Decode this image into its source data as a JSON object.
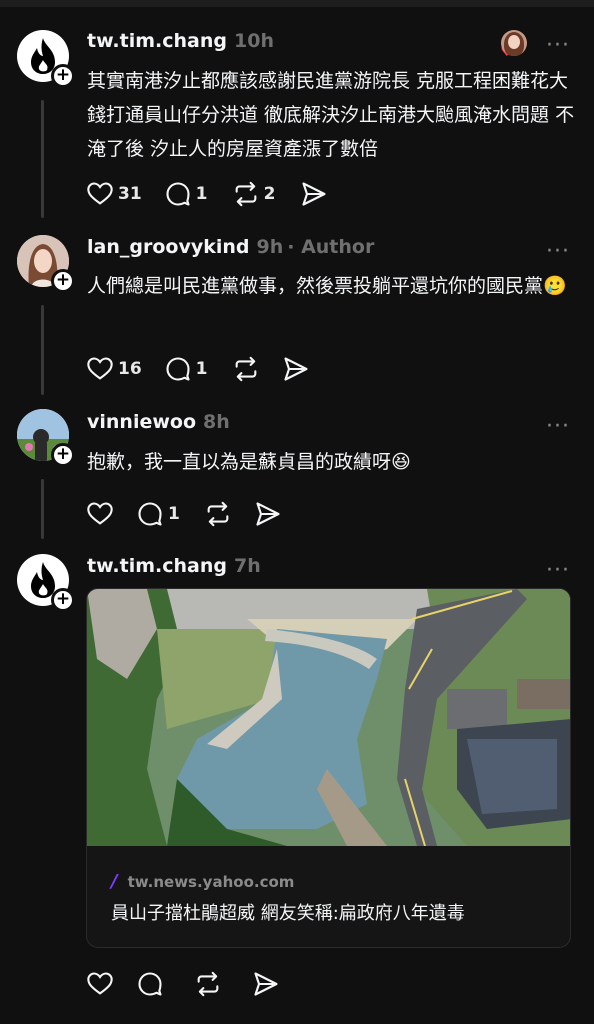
{
  "posts": [
    {
      "username": "tw.tim.chang",
      "time": "10h",
      "text": "其實南港汐止都應該感謝民進黨游院長  克服工程困難花大錢打通員山仔分洪道  徹底解決汐止南港大颱風淹水問題  不淹了後  汐止人的房屋資產漲了數倍",
      "likes": "31",
      "replies": "1",
      "reposts": "2",
      "avatar_icon": "threads-flame-logo",
      "more": "···"
    },
    {
      "username": "lan_groovykind",
      "time": "9h",
      "author_tag": "· Author",
      "text": "人們總是叫民進黨做事，然後票投躺平還坑你的國民黨🥲",
      "likes": "16",
      "replies": "1",
      "more": "···"
    },
    {
      "username": "vinniewoo",
      "time": "8h",
      "text": "抱歉，我一直以為是蘇貞昌的政績呀😆",
      "replies": "1",
      "more": "···"
    },
    {
      "username": "tw.tim.chang",
      "time": "7h",
      "more": "···",
      "link": {
        "domain": "tw.news.yahoo.com",
        "title": "員山子擋杜鵑超威 網友笑稱:扁政府八年遺毒"
      }
    }
  ],
  "colors": {
    "background": "#101010",
    "text": "#f3f5f7",
    "muted": "#6f6f6f",
    "like_heart": "#ff3040",
    "link_accent": "#7b3cff"
  }
}
